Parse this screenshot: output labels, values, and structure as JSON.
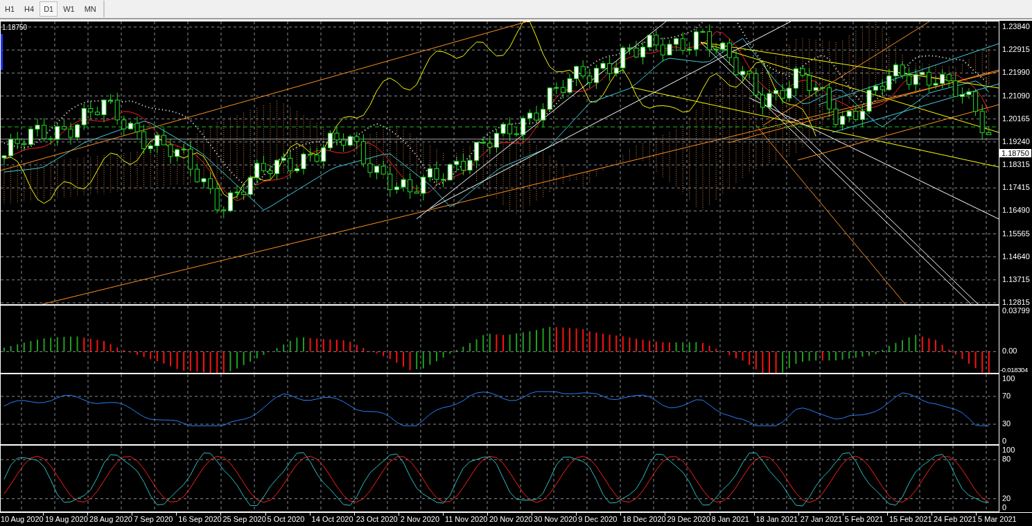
{
  "toolbar": {
    "timeframes": [
      {
        "label": "H1",
        "selected": false
      },
      {
        "label": "H4",
        "selected": false
      },
      {
        "label": "D1",
        "selected": true
      },
      {
        "label": "W1",
        "selected": false
      },
      {
        "label": "MN",
        "selected": false
      }
    ]
  },
  "main_chart": {
    "price_label": "1.18750",
    "current_price": "1.18750",
    "axis_labels": [
      "1.23840",
      "1.22915",
      "1.21990",
      "1.21090",
      "1.20165",
      "1.19240",
      "1.18315",
      "1.17415",
      "1.16490",
      "1.15565",
      "1.14640",
      "1.13715",
      "1.12815"
    ]
  },
  "macd_panel": {
    "axis_labels": [
      "0.03799",
      "0.00",
      "-0.018304"
    ]
  },
  "rsi_panel": {
    "axis_labels": [
      "100",
      "70",
      "30",
      "0"
    ]
  },
  "stochastic_panel": {
    "axis_labels": [
      "100",
      "80",
      "20",
      "0"
    ]
  },
  "time_axis": {
    "labels": [
      "10 Aug 2020",
      "19 Aug 2020",
      "28 Aug 2020",
      "7 Sep 2020",
      "16 Sep 2020",
      "25 Sep 2020",
      "5 Oct 2020",
      "14 Oct 2020",
      "23 Oct 2020",
      "2 Nov 2020",
      "11 Nov 2020",
      "20 Nov 2020",
      "30 Nov 2020",
      "9 Dec 2020",
      "18 Dec 2020",
      "29 Dec 2020",
      "8 Jan 2021",
      "18 Jan 2021",
      "27 Jan 2021",
      "5 Feb 2021",
      "15 Feb 2021",
      "24 Feb 2021",
      "5 Mar 2021"
    ]
  }
}
